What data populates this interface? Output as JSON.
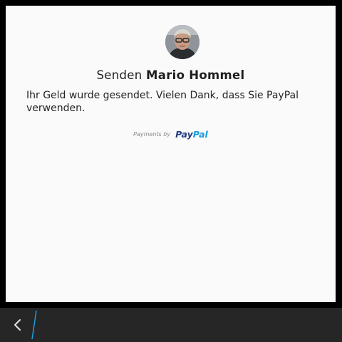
{
  "header": {
    "title_prefix": "Senden",
    "recipient_name": "Mario Hommel"
  },
  "message": "Ihr Geld wurde gesendet. Vielen Dank, dass Sie PayPal verwenden.",
  "footer": {
    "payments_by": "Payments by",
    "logo_pay": "Pay",
    "logo_pal": "Pal"
  },
  "colors": {
    "paypal_dark": "#253b80",
    "paypal_light": "#179bd7",
    "nav_accent": "#1a9fe0"
  },
  "icons": {
    "back": "back-chevron-icon"
  }
}
